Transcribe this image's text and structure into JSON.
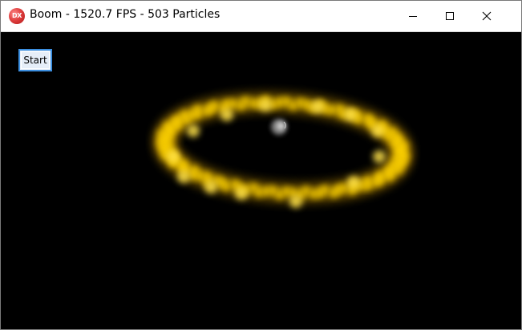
{
  "window": {
    "title": "Boom - 1520.7 FPS - 503 Particles",
    "app_icon_text": "DX",
    "controls": {
      "minimize": "minimize-icon",
      "maximize": "maximize-icon",
      "close": "close-icon"
    }
  },
  "canvas": {
    "start_label": "Start",
    "background_color": "#000000",
    "particle_color": "#ffd400",
    "center_color": "#bbbbbb"
  }
}
